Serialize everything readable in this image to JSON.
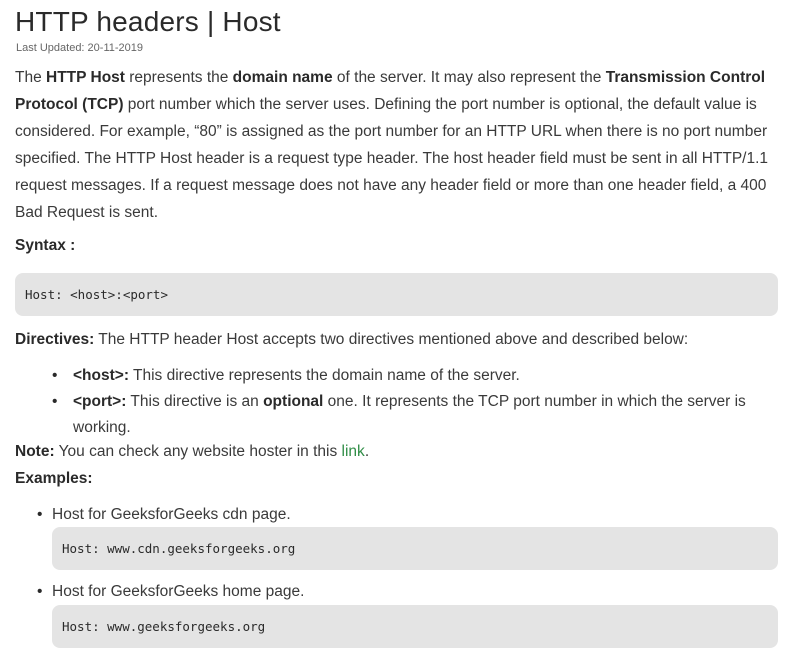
{
  "article": {
    "title": "HTTP headers | Host",
    "last_updated": "Last Updated: 20-11-2019",
    "intro": {
      "t1": "The ",
      "b1": "HTTP Host",
      "t2": " represents the ",
      "b2": "domain name",
      "t3": " of the server. It may also represent the ",
      "b3": "Transmission Control Protocol (TCP)",
      "t4": " port number which the server uses. Defining the port number is optional, the default value is considered. For example, “80” is assigned as the port number for an HTTP URL when there is no port number specified. The HTTP Host header is a request type header. The host header field must be sent in all HTTP/1.1 request messages. If a request message does not have any header field or more than one header field, a 400 Bad Request is sent."
    },
    "syntax_label": "Syntax :",
    "syntax_code": "Host: <host>:<port>",
    "directives": {
      "label": "Directives:",
      "text": " The HTTP header Host accepts two directives mentioned above and described below:"
    },
    "directive_items": [
      {
        "name": "<host>:",
        "t1": " This directive represents the domain name of the server.",
        "bold": "",
        "t2": ""
      },
      {
        "name": "<port>:",
        "t1": " This directive is an ",
        "bold": "optional",
        "t2": " one. It represents the TCP port number in which the server is working."
      }
    ],
    "note": {
      "label": "Note:",
      "text": " You can check any website hoster in this ",
      "link": "link",
      "end": "."
    },
    "examples_label": "Examples:",
    "examples": [
      {
        "text": "Host for GeeksforGeeks cdn page.",
        "code": "Host: www.cdn.geeksforgeeks.org"
      },
      {
        "text": "Host for GeeksforGeeks home page.",
        "code": "Host: www.geeksforgeeks.org"
      }
    ]
  }
}
